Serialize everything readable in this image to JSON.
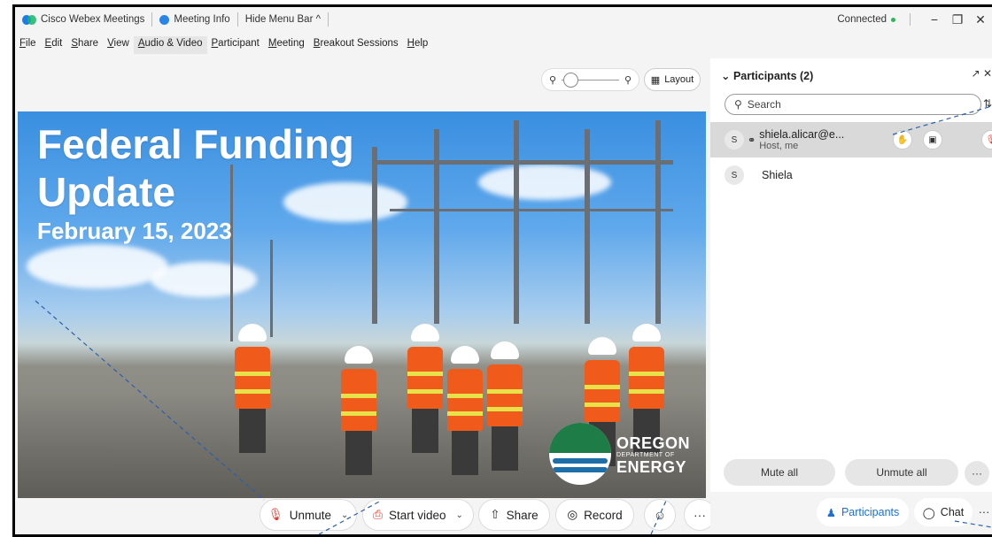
{
  "titlebar": {
    "app_name": "Cisco Webex Meetings",
    "meeting_info": "Meeting Info",
    "hide_menu_bar": "Hide Menu Bar ^",
    "status": "Connected",
    "minimize": "−",
    "restore": "❐",
    "close": "✕"
  },
  "menu": [
    {
      "first": "F",
      "rest": "ile"
    },
    {
      "first": "E",
      "rest": "dit"
    },
    {
      "first": "S",
      "rest": "hare"
    },
    {
      "first": "V",
      "rest": "iew"
    },
    {
      "first": "A",
      "rest": "udio & Video"
    },
    {
      "first": "P",
      "rest": "articipant"
    },
    {
      "first": "M",
      "rest": "eeting"
    },
    {
      "first": "B",
      "rest": "reakout Sessions"
    },
    {
      "first": "H",
      "rest": "elp"
    }
  ],
  "stage": {
    "layout_label": "Layout",
    "zoom_out_icon": "zoom-out-icon",
    "zoom_in_icon": "zoom-in-icon"
  },
  "slide": {
    "title_line1": "Federal Funding",
    "title_line2": "Update",
    "date": "February 15, 2023",
    "logo_big1": "OREGON",
    "logo_small1": "DEPARTMENT OF",
    "logo_big2": "ENERGY"
  },
  "controls": {
    "unmute": "Unmute",
    "start_video": "Start video",
    "share": "Share",
    "record": "Record",
    "more": "···",
    "leave": "✕"
  },
  "panel": {
    "title": "Participants (2)",
    "search_placeholder": "Search",
    "participants": [
      {
        "initial": "S",
        "name": "shiela.alicar@e...",
        "role": "Host, me"
      },
      {
        "initial": "S",
        "name": "Shiela",
        "role": ""
      }
    ],
    "mute_all": "Mute all",
    "unmute_all": "Unmute all",
    "more": "···",
    "footer": {
      "participants": "Participants",
      "chat": "Chat",
      "more": "···"
    }
  },
  "colors": {
    "leave_red": "#e8392c",
    "accent_blue": "#1a7ee6",
    "connected_green": "#2db55d"
  }
}
